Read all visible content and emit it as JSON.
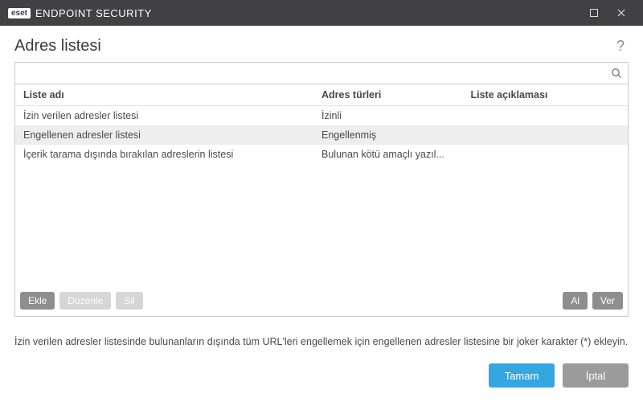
{
  "titlebar": {
    "brand_badge": "eset",
    "brand_text": "ENDPOINT SECURITY"
  },
  "header": {
    "title": "Adres listesi",
    "help": "?"
  },
  "search": {
    "value": "",
    "placeholder": ""
  },
  "table": {
    "columns": {
      "name": "Liste adı",
      "types": "Adres türleri",
      "desc": "Liste açıklaması"
    },
    "rows": [
      {
        "name": "İzin verilen adresler listesi",
        "types": "İzinli",
        "desc": "",
        "selected": false
      },
      {
        "name": "Engellenen adresler listesi",
        "types": "Engellenmiş",
        "desc": "",
        "selected": true
      },
      {
        "name": "İçerik tarama dışında bırakılan adreslerin listesi",
        "types": "Bulunan kötü amaçlı yazıl...",
        "desc": "",
        "selected": false
      }
    ]
  },
  "actions": {
    "add": "Ekle",
    "edit": "Düzenle",
    "delete": "Sil",
    "import": "Al",
    "export": "Ver"
  },
  "hint": "İzin verilen adresler listesinde bulunanların dışında tüm URL'leri engellemek için engellenen adresler listesine bir joker karakter (*) ekleyin.",
  "footer": {
    "ok": "Tamam",
    "cancel": "İptal"
  }
}
